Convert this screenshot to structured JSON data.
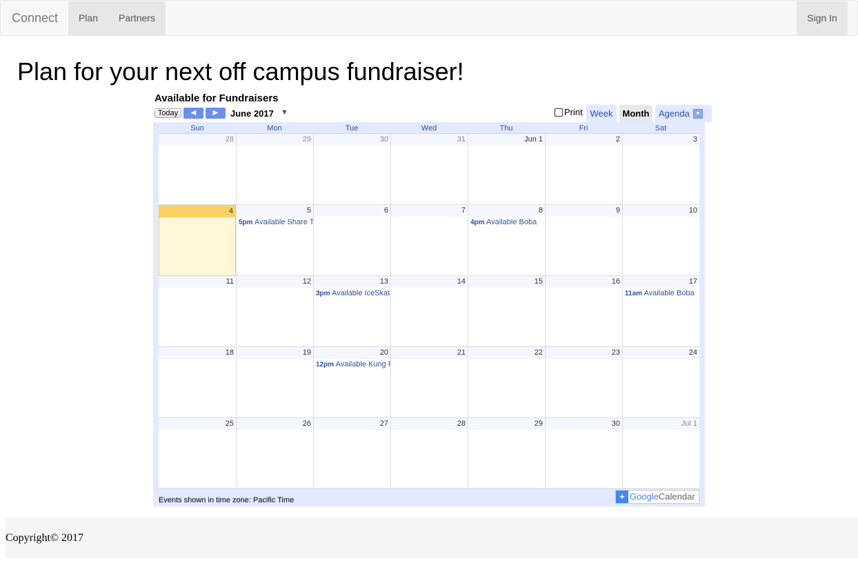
{
  "navbar": {
    "brand": "Connect",
    "links": [
      "Plan",
      "Partners"
    ],
    "sign_in": "Sign In"
  },
  "page_title": "Plan for your next off campus fundraiser!",
  "calendar": {
    "title": "Available for Fundraisers",
    "today_label": "Today",
    "month_label": "June 2017",
    "print_label": "Print",
    "tabs": {
      "week": "Week",
      "month": "Month",
      "agenda": "Agenda"
    },
    "weekdays": [
      "Sun",
      "Mon",
      "Tue",
      "Wed",
      "Thu",
      "Fri",
      "Sat"
    ],
    "weeks": [
      [
        {
          "d": "28",
          "other": true
        },
        {
          "d": "29",
          "other": true
        },
        {
          "d": "30",
          "other": true
        },
        {
          "d": "31",
          "other": true
        },
        {
          "d": "Jun 1"
        },
        {
          "d": "2"
        },
        {
          "d": "3"
        }
      ],
      [
        {
          "d": "4",
          "today": true
        },
        {
          "d": "5",
          "time": "5pm",
          "title": "Available Share Tea"
        },
        {
          "d": "6"
        },
        {
          "d": "7"
        },
        {
          "d": "8",
          "time": "4pm",
          "title": "Available Boba"
        },
        {
          "d": "9"
        },
        {
          "d": "10"
        }
      ],
      [
        {
          "d": "11"
        },
        {
          "d": "12"
        },
        {
          "d": "13",
          "time": "3pm",
          "title": "Available IceSkating"
        },
        {
          "d": "14"
        },
        {
          "d": "15"
        },
        {
          "d": "16"
        },
        {
          "d": "17",
          "time": "11am",
          "title": "Available Boba"
        }
      ],
      [
        {
          "d": "18"
        },
        {
          "d": "19"
        },
        {
          "d": "20",
          "time": "12pm",
          "title": "Available Kung Fu Tea"
        },
        {
          "d": "21"
        },
        {
          "d": "22"
        },
        {
          "d": "23"
        },
        {
          "d": "24"
        }
      ],
      [
        {
          "d": "25"
        },
        {
          "d": "26"
        },
        {
          "d": "27"
        },
        {
          "d": "28"
        },
        {
          "d": "29"
        },
        {
          "d": "30"
        },
        {
          "d": "Jul 1",
          "other": true
        }
      ]
    ],
    "timezone_note": "Events shown in time zone: Pacific Time",
    "google_badge": {
      "google": "Google",
      "calendar": "Calendar"
    },
    "colors": {
      "today_bg": "#fff7d7",
      "today_header": "#fad163",
      "link": "#2952a3",
      "frame": "#e3e9ff"
    }
  },
  "footer": {
    "copyright": "Copyright© 2017"
  }
}
